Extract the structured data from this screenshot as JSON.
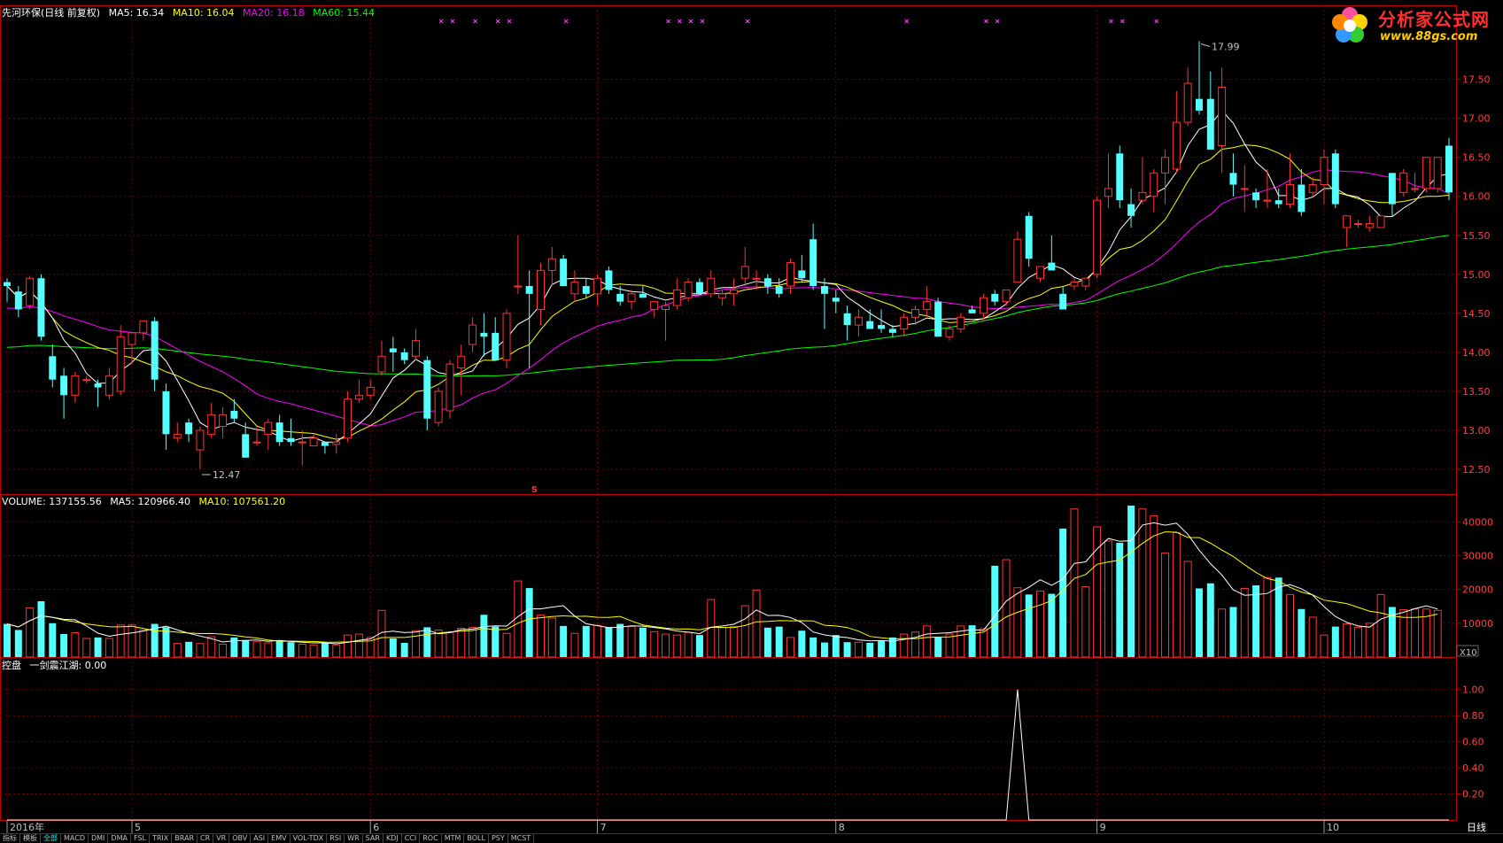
{
  "header": {
    "title": "先河环保(日线 前复权)",
    "ma_items": [
      {
        "label": "MA5: 16.34",
        "color": "#ffffff"
      },
      {
        "label": "MA10: 16.04",
        "color": "#ffff00"
      },
      {
        "label": "MA20: 16.18",
        "color": "#ff00ff"
      },
      {
        "label": "MA60: 15.44",
        "color": "#00ff00"
      }
    ]
  },
  "volume_header": {
    "items": [
      {
        "label": "VOLUME: 137155.56",
        "color": "#ffffff"
      },
      {
        "label": "MA5: 120966.40",
        "color": "#ffffff"
      },
      {
        "label": "MA10: 107561.20",
        "color": "#ffff00"
      }
    ]
  },
  "indicator_header": {
    "items": [
      {
        "label": "控盘",
        "color": "#ffffff"
      },
      {
        "label": "一剑震江湖: 0.00",
        "color": "#ffffff"
      }
    ]
  },
  "logo": {
    "name": "分析家公式网",
    "url_text": "www.88gs.com"
  },
  "annotations": {
    "high": "17.99",
    "low": "12.47",
    "marker": "S",
    "vol_unit": "X10",
    "period": "日线"
  },
  "colors": {
    "up": "#ff3232",
    "down": "#54ffff",
    "ma5": "#ffffff",
    "ma10": "#ffff00",
    "ma20": "#ff00ff",
    "ma60": "#00ff00",
    "grid": "#8b0000",
    "frame": "#c00000",
    "axis_text": "#ff4040"
  },
  "tabs": [
    "指标",
    "模板",
    "全部",
    "MACD",
    "DMI",
    "DMA",
    "FSL",
    "TRIX",
    "BRAR",
    "CR",
    "VR",
    "OBV",
    "ASI",
    "EMV",
    "VOL-TDX",
    "RSI",
    "WR",
    "SAR",
    "KDJ",
    "CCI",
    "ROC",
    "MTM",
    "BOLL",
    "PSY",
    "MCST"
  ],
  "active_tab": "全部",
  "chart_data": [
    {
      "type": "candlestick",
      "y_ticks": [
        "17.50",
        "17.00",
        "16.50",
        "16.00",
        "15.50",
        "15.00",
        "14.50",
        "14.00",
        "13.50",
        "13.00",
        "12.50"
      ],
      "ylim": [
        12.25,
        18.2
      ],
      "x_ticks": [
        {
          "label": "2016年",
          "index": 0
        },
        {
          "label": "5",
          "index": 11
        },
        {
          "label": "6",
          "index": 32
        },
        {
          "label": "7",
          "index": 52
        },
        {
          "label": "8",
          "index": 73
        },
        {
          "label": "9",
          "index": 96
        },
        {
          "label": "10",
          "index": 116
        }
      ],
      "ohlc": [
        [
          14.9,
          14.95,
          14.65,
          14.85
        ],
        [
          14.78,
          14.85,
          14.45,
          14.55
        ],
        [
          14.6,
          14.98,
          14.55,
          14.95
        ],
        [
          14.95,
          15.0,
          14.15,
          14.2
        ],
        [
          13.95,
          14.1,
          13.55,
          13.65
        ],
        [
          13.7,
          13.8,
          13.15,
          13.45
        ],
        [
          13.45,
          13.75,
          13.35,
          13.7
        ],
        [
          13.65,
          13.7,
          13.6,
          13.65
        ],
        [
          13.6,
          13.65,
          13.3,
          13.55
        ],
        [
          13.45,
          13.8,
          13.4,
          13.7
        ],
        [
          13.5,
          14.35,
          13.45,
          14.2
        ],
        [
          14.1,
          14.25,
          13.85,
          14.25
        ],
        [
          14.25,
          14.4,
          14.15,
          14.4
        ],
        [
          14.4,
          14.45,
          13.5,
          13.65
        ],
        [
          13.5,
          13.6,
          12.75,
          12.95
        ],
        [
          12.9,
          13.1,
          12.85,
          12.95
        ],
        [
          13.1,
          13.15,
          12.85,
          12.95
        ],
        [
          12.75,
          13.05,
          12.5,
          13.0
        ],
        [
          12.95,
          13.35,
          12.9,
          13.2
        ],
        [
          13.05,
          13.3,
          12.9,
          13.2
        ],
        [
          13.25,
          13.4,
          13.1,
          13.15
        ],
        [
          12.95,
          13.1,
          12.65,
          12.65
        ],
        [
          12.85,
          13.05,
          12.8,
          12.85
        ],
        [
          12.95,
          13.15,
          12.75,
          13.1
        ],
        [
          13.1,
          13.2,
          12.8,
          12.85
        ],
        [
          12.9,
          13.15,
          12.8,
          12.85
        ],
        [
          12.85,
          13.0,
          12.55,
          12.85
        ],
        [
          12.8,
          12.95,
          12.8,
          12.9
        ],
        [
          12.85,
          12.85,
          12.7,
          12.8
        ],
        [
          12.82,
          12.95,
          12.7,
          12.85
        ],
        [
          12.9,
          13.5,
          12.85,
          13.4
        ],
        [
          13.4,
          13.65,
          13.35,
          13.45
        ],
        [
          13.45,
          13.65,
          13.4,
          13.55
        ],
        [
          13.75,
          14.15,
          13.7,
          13.95
        ],
        [
          14.05,
          14.2,
          13.75,
          14.0
        ],
        [
          14.0,
          14.05,
          13.85,
          13.9
        ],
        [
          13.95,
          14.3,
          13.9,
          14.15
        ],
        [
          13.9,
          13.95,
          13.0,
          13.15
        ],
        [
          13.1,
          13.55,
          13.05,
          13.5
        ],
        [
          13.25,
          13.9,
          13.15,
          13.85
        ],
        [
          13.8,
          14.1,
          13.45,
          13.95
        ],
        [
          14.1,
          14.45,
          14.0,
          14.35
        ],
        [
          14.25,
          14.5,
          13.95,
          14.2
        ],
        [
          14.25,
          14.45,
          13.9,
          13.9
        ],
        [
          13.9,
          14.55,
          13.8,
          14.5
        ],
        [
          14.85,
          15.5,
          14.75,
          14.85
        ],
        [
          14.85,
          15.05,
          13.8,
          14.75
        ],
        [
          14.55,
          15.15,
          14.35,
          15.05
        ],
        [
          15.05,
          15.35,
          14.85,
          15.2
        ],
        [
          15.2,
          15.25,
          14.85,
          14.85
        ],
        [
          14.75,
          15.05,
          14.65,
          14.9
        ],
        [
          14.85,
          14.95,
          14.7,
          14.75
        ],
        [
          14.75,
          15.0,
          14.6,
          14.95
        ],
        [
          15.05,
          15.1,
          14.75,
          14.8
        ],
        [
          14.75,
          14.85,
          14.6,
          14.65
        ],
        [
          14.65,
          14.8,
          14.55,
          14.75
        ],
        [
          14.75,
          14.85,
          14.7,
          14.7
        ],
        [
          14.55,
          14.65,
          14.45,
          14.65
        ],
        [
          14.55,
          14.65,
          14.15,
          14.6
        ],
        [
          14.6,
          14.95,
          14.55,
          14.8
        ],
        [
          14.7,
          14.95,
          14.65,
          14.9
        ],
        [
          14.9,
          14.95,
          14.75,
          14.75
        ],
        [
          14.75,
          15.05,
          14.7,
          14.95
        ],
        [
          14.7,
          14.8,
          14.6,
          14.75
        ],
        [
          14.75,
          14.95,
          14.6,
          14.8
        ],
        [
          14.95,
          15.35,
          14.85,
          15.1
        ],
        [
          14.95,
          15.05,
          14.8,
          14.95
        ],
        [
          14.95,
          15.0,
          14.75,
          14.85
        ],
        [
          14.85,
          14.95,
          14.7,
          14.75
        ],
        [
          14.85,
          15.2,
          14.75,
          15.15
        ],
        [
          15.05,
          15.25,
          14.9,
          14.95
        ],
        [
          15.45,
          15.65,
          14.8,
          14.85
        ],
        [
          14.85,
          14.95,
          14.3,
          14.75
        ],
        [
          14.7,
          14.8,
          14.5,
          14.65
        ],
        [
          14.5,
          14.6,
          14.15,
          14.35
        ],
        [
          14.35,
          14.55,
          14.2,
          14.45
        ],
        [
          14.4,
          14.55,
          14.3,
          14.3
        ],
        [
          14.35,
          14.55,
          14.25,
          14.3
        ],
        [
          14.3,
          14.35,
          14.2,
          14.25
        ],
        [
          14.3,
          14.5,
          14.2,
          14.45
        ],
        [
          14.45,
          14.6,
          14.35,
          14.55
        ],
        [
          14.55,
          14.85,
          14.45,
          14.65
        ],
        [
          14.65,
          14.7,
          14.25,
          14.2
        ],
        [
          14.2,
          14.35,
          14.15,
          14.3
        ],
        [
          14.3,
          14.5,
          14.25,
          14.45
        ],
        [
          14.55,
          14.6,
          14.5,
          14.5
        ],
        [
          14.5,
          14.75,
          14.4,
          14.7
        ],
        [
          14.75,
          14.8,
          14.6,
          14.65
        ],
        [
          14.65,
          14.75,
          14.6,
          14.8
        ],
        [
          14.9,
          15.55,
          14.9,
          15.45
        ],
        [
          15.75,
          15.8,
          15.1,
          15.2
        ],
        [
          14.95,
          15.1,
          14.9,
          15.1
        ],
        [
          15.15,
          15.5,
          15.05,
          15.05
        ],
        [
          14.75,
          14.85,
          14.55,
          14.55
        ],
        [
          14.85,
          14.95,
          14.8,
          14.9
        ],
        [
          14.85,
          14.95,
          14.8,
          14.95
        ],
        [
          15.0,
          16.0,
          14.95,
          15.95
        ],
        [
          16.0,
          16.55,
          15.85,
          16.1
        ],
        [
          16.55,
          16.65,
          15.85,
          15.95
        ],
        [
          15.9,
          16.1,
          15.6,
          15.75
        ],
        [
          15.95,
          16.5,
          15.9,
          16.05
        ],
        [
          16.0,
          16.35,
          15.8,
          16.3
        ],
        [
          16.3,
          16.6,
          15.9,
          16.5
        ],
        [
          16.35,
          17.35,
          16.3,
          16.95
        ],
        [
          16.95,
          17.65,
          16.9,
          17.45
        ],
        [
          17.25,
          17.99,
          17.05,
          17.1
        ],
        [
          17.25,
          17.6,
          16.75,
          16.6
        ],
        [
          16.65,
          17.65,
          16.3,
          17.4
        ],
        [
          16.3,
          16.55,
          16.0,
          16.15
        ],
        [
          16.1,
          16.4,
          15.8,
          16.1
        ],
        [
          16.05,
          16.1,
          15.85,
          15.95
        ],
        [
          15.95,
          16.35,
          15.85,
          15.95
        ],
        [
          15.95,
          16.1,
          15.85,
          15.9
        ],
        [
          15.9,
          16.55,
          15.85,
          16.15
        ],
        [
          16.15,
          16.35,
          15.75,
          15.8
        ],
        [
          16.05,
          16.25,
          16.0,
          16.15
        ],
        [
          16.15,
          16.6,
          15.9,
          16.5
        ],
        [
          16.55,
          16.6,
          15.85,
          15.9
        ],
        [
          15.6,
          15.75,
          15.35,
          15.75
        ],
        [
          15.65,
          15.7,
          15.6,
          15.65
        ],
        [
          15.6,
          15.75,
          15.55,
          15.65
        ],
        [
          15.6,
          15.75,
          15.6,
          15.75
        ],
        [
          16.3,
          16.3,
          15.75,
          15.9
        ],
        [
          16.05,
          16.35,
          16.0,
          16.3
        ],
        [
          16.1,
          16.3,
          16.05,
          16.1
        ],
        [
          16.1,
          16.5,
          16.05,
          16.5
        ],
        [
          16.1,
          16.5,
          16.05,
          16.5
        ],
        [
          16.65,
          16.75,
          15.95,
          16.05
        ]
      ]
    },
    {
      "type": "bar",
      "y_ticks": [
        "40000",
        "30000",
        "20000",
        "10000"
      ],
      "ylim": [
        0,
        44000
      ],
      "unit": "X10",
      "values": [
        9800,
        8000,
        14500,
        16500,
        10000,
        6800,
        7200,
        5500,
        5800,
        5500,
        9500,
        9500,
        8000,
        9800,
        8800,
        4000,
        4500,
        4000,
        6000,
        3800,
        5800,
        5000,
        4500,
        4200,
        5000,
        4400,
        3800,
        3600,
        4200,
        3600,
        6500,
        6800,
        5800,
        13800,
        5500,
        4200,
        7800,
        8800,
        8000,
        7300,
        8500,
        8800,
        12500,
        9000,
        7000,
        22500,
        20400,
        12400,
        11500,
        9200,
        7000,
        9200,
        9400,
        8800,
        9800,
        9000,
        8700,
        7500,
        6800,
        6500,
        7300,
        6500,
        17000,
        8700,
        9000,
        15200,
        19800,
        8700,
        9000,
        5800,
        7800,
        5800,
        4300,
        6500,
        4400,
        4400,
        4200,
        4800,
        5800,
        6800,
        7400,
        9200,
        5800,
        6800,
        9200,
        9400,
        8400,
        27000,
        28800,
        20500,
        18500,
        19500,
        18700,
        38000,
        43800,
        20800,
        38500,
        34300,
        33800,
        44800,
        43800,
        41800,
        30800,
        36800,
        28300,
        20300,
        21800,
        14200,
        14800,
        20300,
        21200,
        23500,
        23500,
        18500,
        14200,
        11800,
        6500,
        9000,
        9800,
        8800,
        10000,
        18500,
        14800,
        14000,
        14200,
        14200,
        13800
      ]
    },
    {
      "type": "line",
      "y_ticks": [
        "1.00",
        "0.80",
        "0.60",
        "0.40",
        "0.20"
      ],
      "ylim": [
        0,
        1.1
      ],
      "values_note_index": 89,
      "spike_value": 1.0
    }
  ]
}
